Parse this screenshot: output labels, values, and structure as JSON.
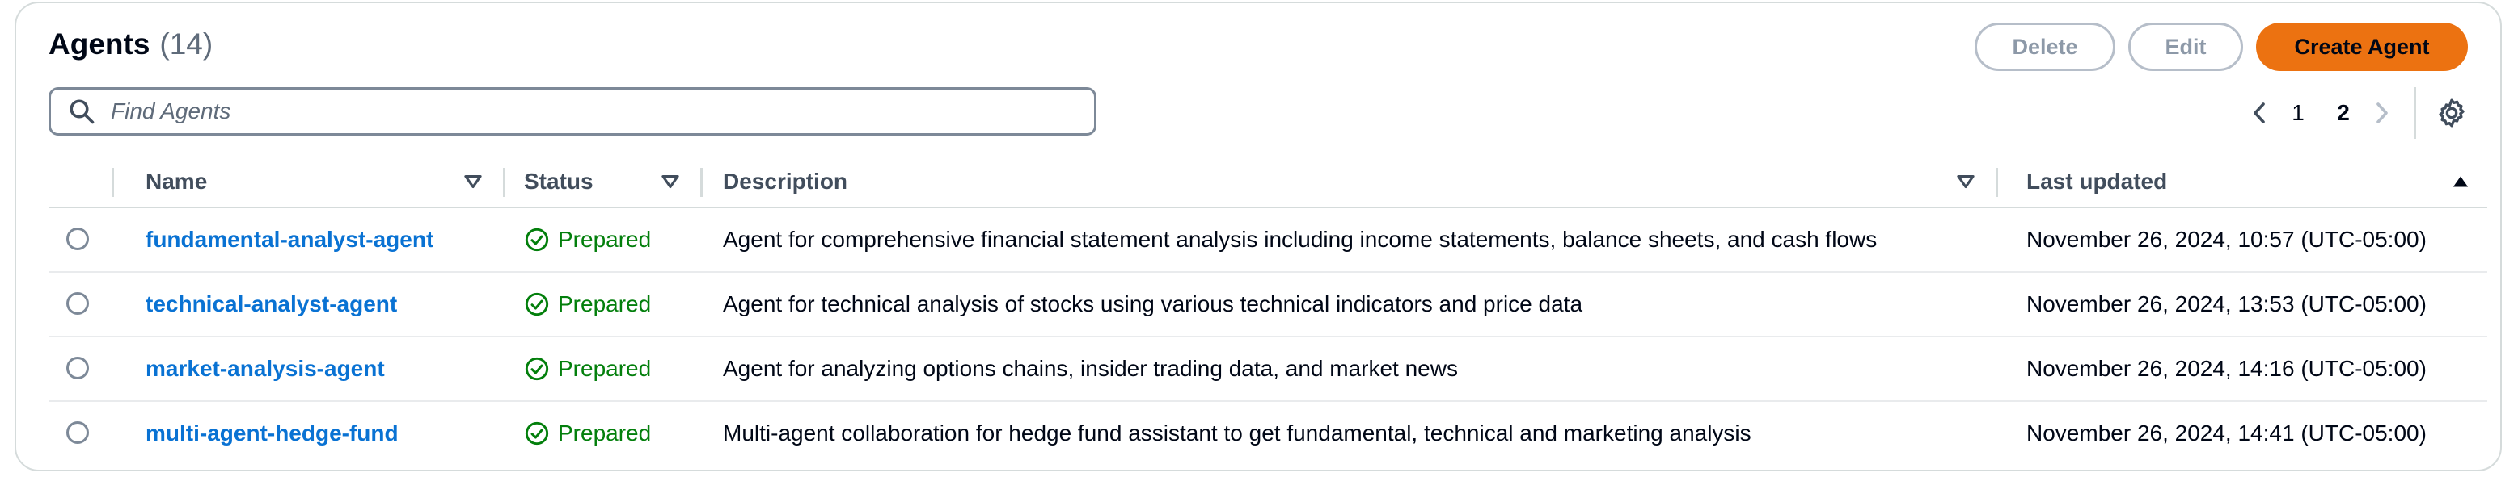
{
  "header": {
    "title": "Agents",
    "count": "(14)"
  },
  "actions": {
    "delete_label": "Delete",
    "edit_label": "Edit",
    "create_label": "Create Agent"
  },
  "search": {
    "placeholder": "Find Agents",
    "value": ""
  },
  "pagination": {
    "pages": [
      "1",
      "2"
    ],
    "current_page": "2"
  },
  "table": {
    "columns": {
      "name": "Name",
      "status": "Status",
      "description": "Description",
      "last_updated": "Last updated"
    },
    "rows": [
      {
        "name": "fundamental-analyst-agent",
        "status": "Prepared",
        "description": "Agent for comprehensive financial statement analysis including income statements, balance sheets, and cash flows",
        "last_updated": "November 26, 2024, 10:57 (UTC-05:00)"
      },
      {
        "name": "technical-analyst-agent",
        "status": "Prepared",
        "description": "Agent for technical analysis of stocks using various technical indicators and price data",
        "last_updated": "November 26, 2024, 13:53 (UTC-05:00)"
      },
      {
        "name": "market-analysis-agent",
        "status": "Prepared",
        "description": "Agent for analyzing options chains, insider trading data, and market news",
        "last_updated": "November 26, 2024, 14:16 (UTC-05:00)"
      },
      {
        "name": "multi-agent-hedge-fund",
        "status": "Prepared",
        "description": "Multi-agent collaboration for hedge fund assistant to get fundamental, technical and marketing analysis",
        "last_updated": "November 26, 2024, 14:41 (UTC-05:00)"
      }
    ]
  },
  "colors": {
    "primary_button": "#ec7211",
    "link": "#0972d3",
    "status_success": "#037f0c",
    "border": "#d5dbdb"
  },
  "icons": {
    "search": "search-icon",
    "prev": "chevron-left-icon",
    "next": "chevron-right-icon",
    "settings": "gear-icon",
    "filter": "filter-caret-icon",
    "sort": "sort-ascending-icon",
    "status": "check-circle-icon"
  }
}
